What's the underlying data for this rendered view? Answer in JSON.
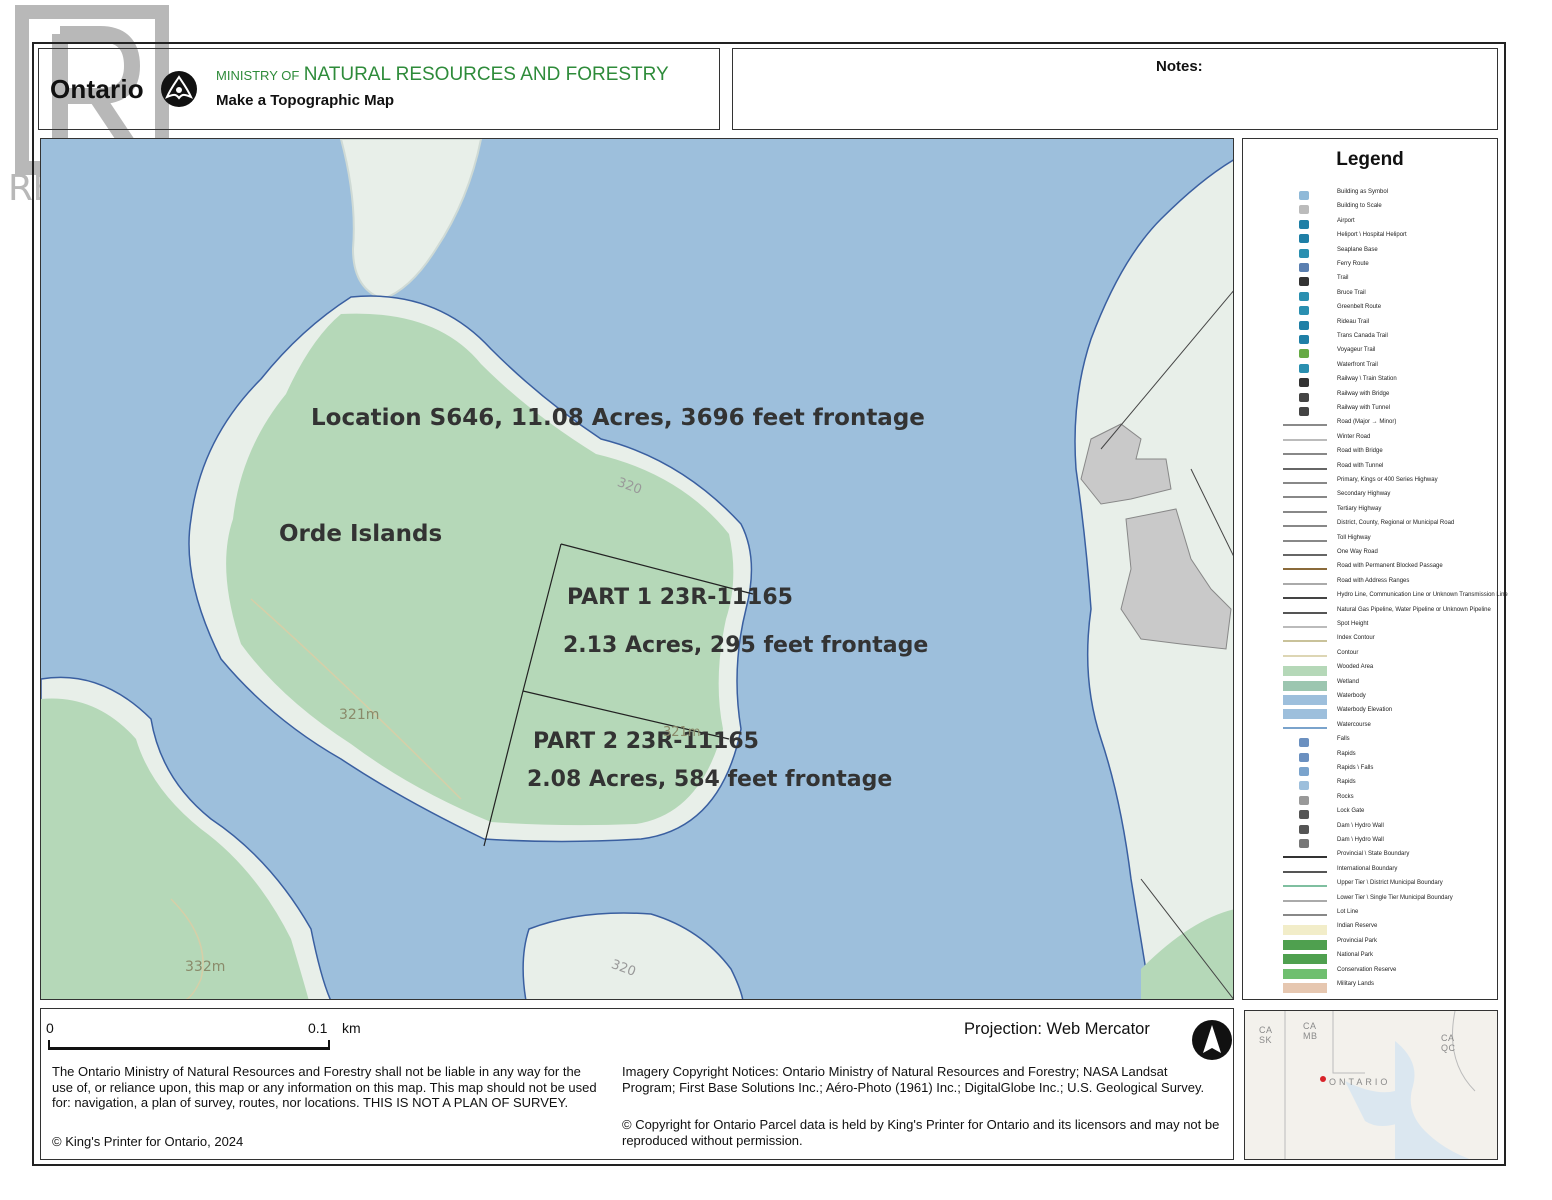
{
  "watermark": {
    "brand": "REALTOR",
    "registered_mark": "®"
  },
  "header": {
    "logo_text": "Ontario",
    "ministry_prefix": "MINISTRY OF",
    "ministry_name": "NATURAL RESOURCES AND FORESTRY",
    "subtitle": "Make a Topographic Map",
    "notes_label": "Notes:"
  },
  "map": {
    "labels": {
      "location": "Location S646, 11.08 Acres, 3696 feet frontage",
      "islands": "Orde Islands",
      "part1": "PART 1 23R-11165",
      "part1_area": "2.13 Acres, 295 feet frontage",
      "part2": "PART 2 23R-11165",
      "part2_area": "2.08 Acres, 584 feet frontage",
      "contour_320_a": "320",
      "contour_321": "321m",
      "contour_321_b": "321m",
      "contour_332": "332m",
      "contour_320_b": "320"
    },
    "colors": {
      "water": "#9dbfdc",
      "land": "#e8efe9",
      "wooded": "#b5d8b8",
      "parcel_line": "#222222",
      "shore_line": "#3a5fa0"
    }
  },
  "legend": {
    "title": "Legend",
    "items": [
      {
        "label": "Building as Symbol"
      },
      {
        "label": "Building to Scale"
      },
      {
        "label": "Airport"
      },
      {
        "label": "Heliport \\ Hospital Heliport"
      },
      {
        "label": "Seaplane Base"
      },
      {
        "label": "Ferry Route"
      },
      {
        "label": "Trail"
      },
      {
        "label": "Bruce Trail"
      },
      {
        "label": "Greenbelt Route"
      },
      {
        "label": "Rideau Trail"
      },
      {
        "label": "Trans Canada Trail"
      },
      {
        "label": "Voyageur Trail"
      },
      {
        "label": "Waterfront Trail"
      },
      {
        "label": "Railway \\ Train Station"
      },
      {
        "label": "Railway with Bridge"
      },
      {
        "label": "Railway with Tunnel"
      },
      {
        "label": "Road (Major → Minor)"
      },
      {
        "label": "Winter Road"
      },
      {
        "label": "Road with Bridge"
      },
      {
        "label": "Road with Tunnel"
      },
      {
        "label": "Primary, Kings or 400 Series Highway"
      },
      {
        "label": "Secondary Highway"
      },
      {
        "label": "Tertiary Highway"
      },
      {
        "label": "District, County, Regional or Municipal Road"
      },
      {
        "label": "Toll Highway"
      },
      {
        "label": "One Way Road"
      },
      {
        "label": "Road with Permanent Blocked Passage"
      },
      {
        "label": "Road with Address Ranges"
      },
      {
        "label": "Hydro Line, Communication Line or Unknown Transmission Line"
      },
      {
        "label": "Natural Gas Pipeline, Water Pipeline or Unknown Pipeline"
      },
      {
        "label": "Spot Height"
      },
      {
        "label": "Index Contour"
      },
      {
        "label": "Contour"
      },
      {
        "label": "Wooded Area"
      },
      {
        "label": "Wetland"
      },
      {
        "label": "Waterbody"
      },
      {
        "label": "Waterbody Elevation"
      },
      {
        "label": "Watercourse"
      },
      {
        "label": "Falls"
      },
      {
        "label": "Rapids"
      },
      {
        "label": "Rapids \\ Falls"
      },
      {
        "label": "Rapids"
      },
      {
        "label": "Rocks"
      },
      {
        "label": "Lock Gate"
      },
      {
        "label": "Dam \\ Hydro Wall"
      },
      {
        "label": "Dam \\ Hydro Wall"
      },
      {
        "label": "Provincial \\ State Boundary"
      },
      {
        "label": "International Boundary"
      },
      {
        "label": "Upper Tier \\ District Municipal Boundary"
      },
      {
        "label": "Lower Tier \\ Single Tier Municipal Boundary"
      },
      {
        "label": "Lot Line"
      },
      {
        "label": "Indian Reserve"
      },
      {
        "label": "Provincial Park"
      },
      {
        "label": "National Park"
      },
      {
        "label": "Conservation Reserve"
      },
      {
        "label": "Military Lands"
      }
    ]
  },
  "footer": {
    "scale_zero": "0",
    "scale_value": "0.1",
    "scale_unit": "km",
    "disclaimer": "The Ontario Ministry of Natural Resources and Forestry shall not be liable in any way for the use of, or reliance upon, this map or any information on this map.  This map should not be used for: navigation, a plan of survey, routes, nor locations. THIS IS NOT A PLAN OF SURVEY.",
    "copyright": "© King's Printer for Ontario,  2024",
    "projection": "Projection: Web Mercator",
    "imagery_notice": "Imagery Copyright Notices: Ontario Ministry of Natural Resources and Forestry; NASA Landsat Program; First Base Solutions Inc.; Aéro-Photo (1961) Inc.; DigitalGlobe Inc.; U.S. Geological Survey.",
    "parcel_notice": "© Copyright for Ontario Parcel data is held by King's Printer for Ontario and its licensors and may not be reproduced without permission."
  },
  "inset": {
    "labels": {
      "ca_sk_1": "CA",
      "ca_sk_2": "SK",
      "ca_mb_1": "CA",
      "ca_mb_2": "MB",
      "ca_qc_1": "CA",
      "ca_qc_2": "QC",
      "province": "ONTARIO"
    }
  }
}
